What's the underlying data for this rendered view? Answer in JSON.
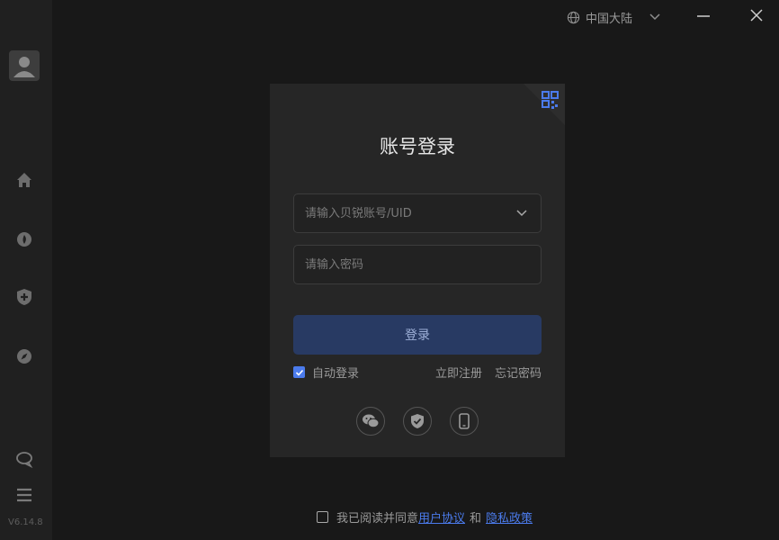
{
  "window": {
    "region_label": "中国大陆",
    "controls": {
      "minimize": "minimize",
      "close": "close"
    }
  },
  "sidebar": {
    "items": [
      {
        "name": "home",
        "icon": "home-icon"
      },
      {
        "name": "discover",
        "icon": "compass-flame-icon"
      },
      {
        "name": "security",
        "icon": "shield-plus-icon"
      },
      {
        "name": "explore",
        "icon": "compass-icon"
      }
    ],
    "bottom": [
      {
        "name": "feedback",
        "icon": "chat-bubble-icon"
      },
      {
        "name": "menu",
        "icon": "menu-icon"
      }
    ],
    "version": "V6.14.8"
  },
  "login": {
    "title": "账号登录",
    "account_placeholder": "请输入贝锐账号/UID",
    "password_placeholder": "请输入密码",
    "submit_label": "登录",
    "auto_login_label": "自动登录",
    "auto_login_checked": true,
    "register_label": "立即注册",
    "forgot_label": "忘记密码",
    "social": [
      {
        "name": "wechat",
        "icon": "wechat-icon"
      },
      {
        "name": "shield",
        "icon": "shield-check-icon"
      },
      {
        "name": "phone",
        "icon": "phone-icon"
      }
    ],
    "qr_icon": "qr-code-icon"
  },
  "agreement": {
    "prefix": "我已阅读并同意",
    "terms_label": "用户协议",
    "joiner": "和",
    "privacy_label": "隐私政策"
  },
  "colors": {
    "accent": "#4b7bec",
    "login_button": "#283a63",
    "panel": "#262626",
    "background": "#181818",
    "sidebar": "#202020"
  }
}
